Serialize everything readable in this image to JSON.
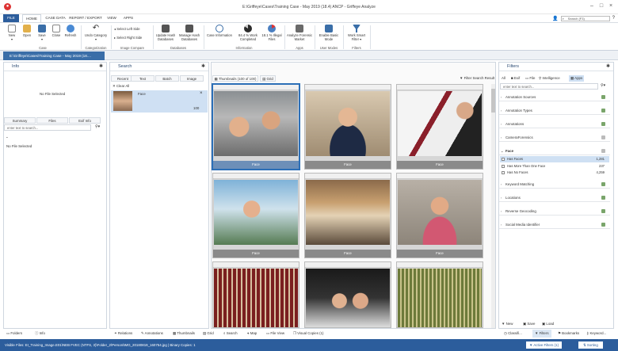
{
  "window": {
    "title": "E:\\Griffeye\\Cases\\Training Case - May 2019 (18.4) ANCP - Griffeye Analyze"
  },
  "menu": {
    "tabs": [
      "FILE",
      "HOME",
      "CASE DATA",
      "REPORT / EXPORT",
      "VIEW",
      "APPS"
    ],
    "search_placeholder": "Search (F3)"
  },
  "ribbon": {
    "buttons": [
      "New",
      "Open",
      "Save",
      "Close",
      "Refresh",
      "Undo Category",
      "Update Hash Databases",
      "Manage Hash Databases",
      "Case Information",
      "Work Completed",
      "Illegal Files",
      "Analyze Forensic Market",
      "Enable Basic Mode",
      "Work Smart Filter"
    ],
    "pct1": "84.4 %",
    "pct2": "18.1 %",
    "select_left": "Select Left Side",
    "select_right": "Select Right Side",
    "groups": [
      "Case",
      "Categorization",
      "Image Compare",
      "Databases",
      "Information",
      "Apps",
      "User Modes",
      "Filters"
    ]
  },
  "case_tab": "E:\\Griffeye\\Cases\\Training Case - May 2019 (18....",
  "info": {
    "title": "Info",
    "no_file": "No File Selected",
    "tabs": [
      "Summary",
      "Files",
      "Exif Info"
    ],
    "search_placeholder": "enter text to search...",
    "no_file2": "No File Selected"
  },
  "search_panel": {
    "title": "Search",
    "tabs": [
      "Recent",
      "Text",
      "Batch",
      "Image"
    ],
    "clear_all": "Clear All",
    "recent_label": "Face",
    "recent_count": "100"
  },
  "thumbs": {
    "tab1": "Thumbnails (100 of 100)",
    "tab2": "Grid",
    "filter_label": "Filter Search Result",
    "labels": [
      "Face",
      "Face",
      "Face",
      "Face",
      "Face",
      "Face",
      "",
      "",
      ""
    ]
  },
  "filters": {
    "title": "Filters",
    "tabs": [
      "All",
      "Exif",
      "File",
      "Intelligence",
      "Apps"
    ],
    "search_placeholder": "enter text to search...",
    "items": [
      "Annotation Sources",
      "Annotation Types",
      "Annotations",
      "CameraForensics",
      "Face",
      "Keyword Matching",
      "Locations",
      "Reverse Geocoding",
      "Social Media Identifier"
    ],
    "face_sub": [
      {
        "label": "Has Faces",
        "count": "1,281"
      },
      {
        "label": "Has More Than One Face",
        "count": "237"
      },
      {
        "label": "Has No Faces",
        "count": "4,259"
      }
    ],
    "bottom": [
      "New",
      "Save",
      "Load"
    ]
  },
  "bottom_tabs": {
    "left": [
      "Folders",
      "Info"
    ],
    "center": [
      "Relations",
      "Annotations",
      "Thumbnails",
      "Grid",
      "Search",
      "Map",
      "File View",
      "Visual Copies (1)"
    ],
    "right": [
      "Classifi...",
      "Filters",
      "Bookmarks",
      "Keyword..."
    ]
  },
  "status": {
    "text": "Visible Files: EI_Training_Image.E01\\NEB FVEC (NTFS, 3)\\Folder_2\\Person\\IMG_20180819_160754.jpg  |  Binary Copies: 1",
    "active_filters": "Active Filters (1)",
    "sorting": "Sorting"
  }
}
